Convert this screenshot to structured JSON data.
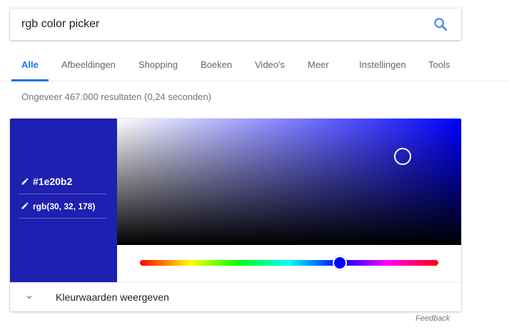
{
  "search": {
    "query": "rgb color picker",
    "icon": "search-icon"
  },
  "tabs": [
    {
      "label": "Alle",
      "active": true
    },
    {
      "label": "Afbeeldingen",
      "active": false
    },
    {
      "label": "Shopping",
      "active": false
    },
    {
      "label": "Boeken",
      "active": false
    },
    {
      "label": "Video's",
      "active": false
    },
    {
      "label": "Meer",
      "active": false
    },
    {
      "label": "Instellingen",
      "active": false
    },
    {
      "label": "Tools",
      "active": false
    }
  ],
  "result_stats": "Ongeveer 467.000 resultaten (0,24 seconden)",
  "color_picker": {
    "hex": "#1e20b2",
    "rgb": "rgb(30, 32, 178)",
    "swatch_color": "#1e20b2",
    "hue_color": "#0000ff",
    "saturation": 0.83,
    "value": 0.7,
    "hue_fraction": 0.67,
    "expand_label": "Kleurwaarden weergeven"
  },
  "colors": {
    "accent": "#1a73e8"
  },
  "feedback": "Feedback"
}
